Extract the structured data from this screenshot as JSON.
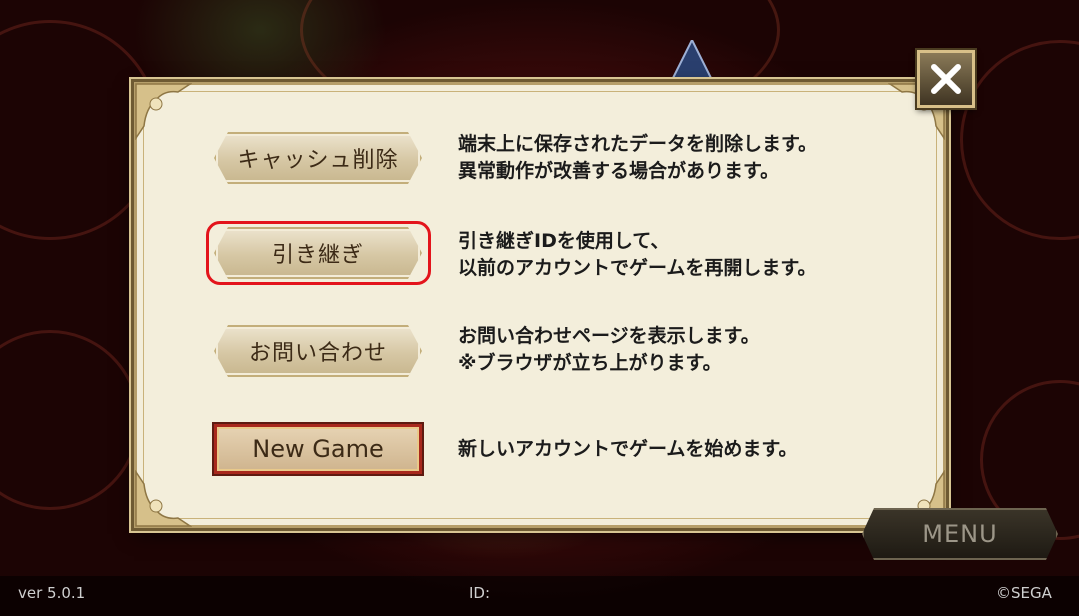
{
  "dialog": {
    "rows": [
      {
        "button_label": "キャッシュ削除",
        "description_line1": "端末上に保存されたデータを削除します。",
        "description_line2": "異常動作が改善する場合があります。"
      },
      {
        "button_label": "引き継ぎ",
        "description_line1": "引き継ぎIDを使用して、",
        "description_line2": "以前のアカウントでゲームを再開します。"
      },
      {
        "button_label": "お問い合わせ",
        "description_line1": "お問い合わせページを表示します。",
        "description_line2": "※ブラウザが立ち上がります。"
      },
      {
        "button_label": "New Game",
        "description_line1": "新しいアカウントでゲームを始めます。"
      }
    ],
    "close_icon": "close-x-icon"
  },
  "menu": {
    "label": "MENU"
  },
  "footer": {
    "version": "ver 5.0.1",
    "id_label": "ID:",
    "copyright": "©SEGA"
  },
  "colors": {
    "highlight": "#e3141b",
    "panel": "#f3eedb",
    "new_game_border": "#a8281c"
  }
}
